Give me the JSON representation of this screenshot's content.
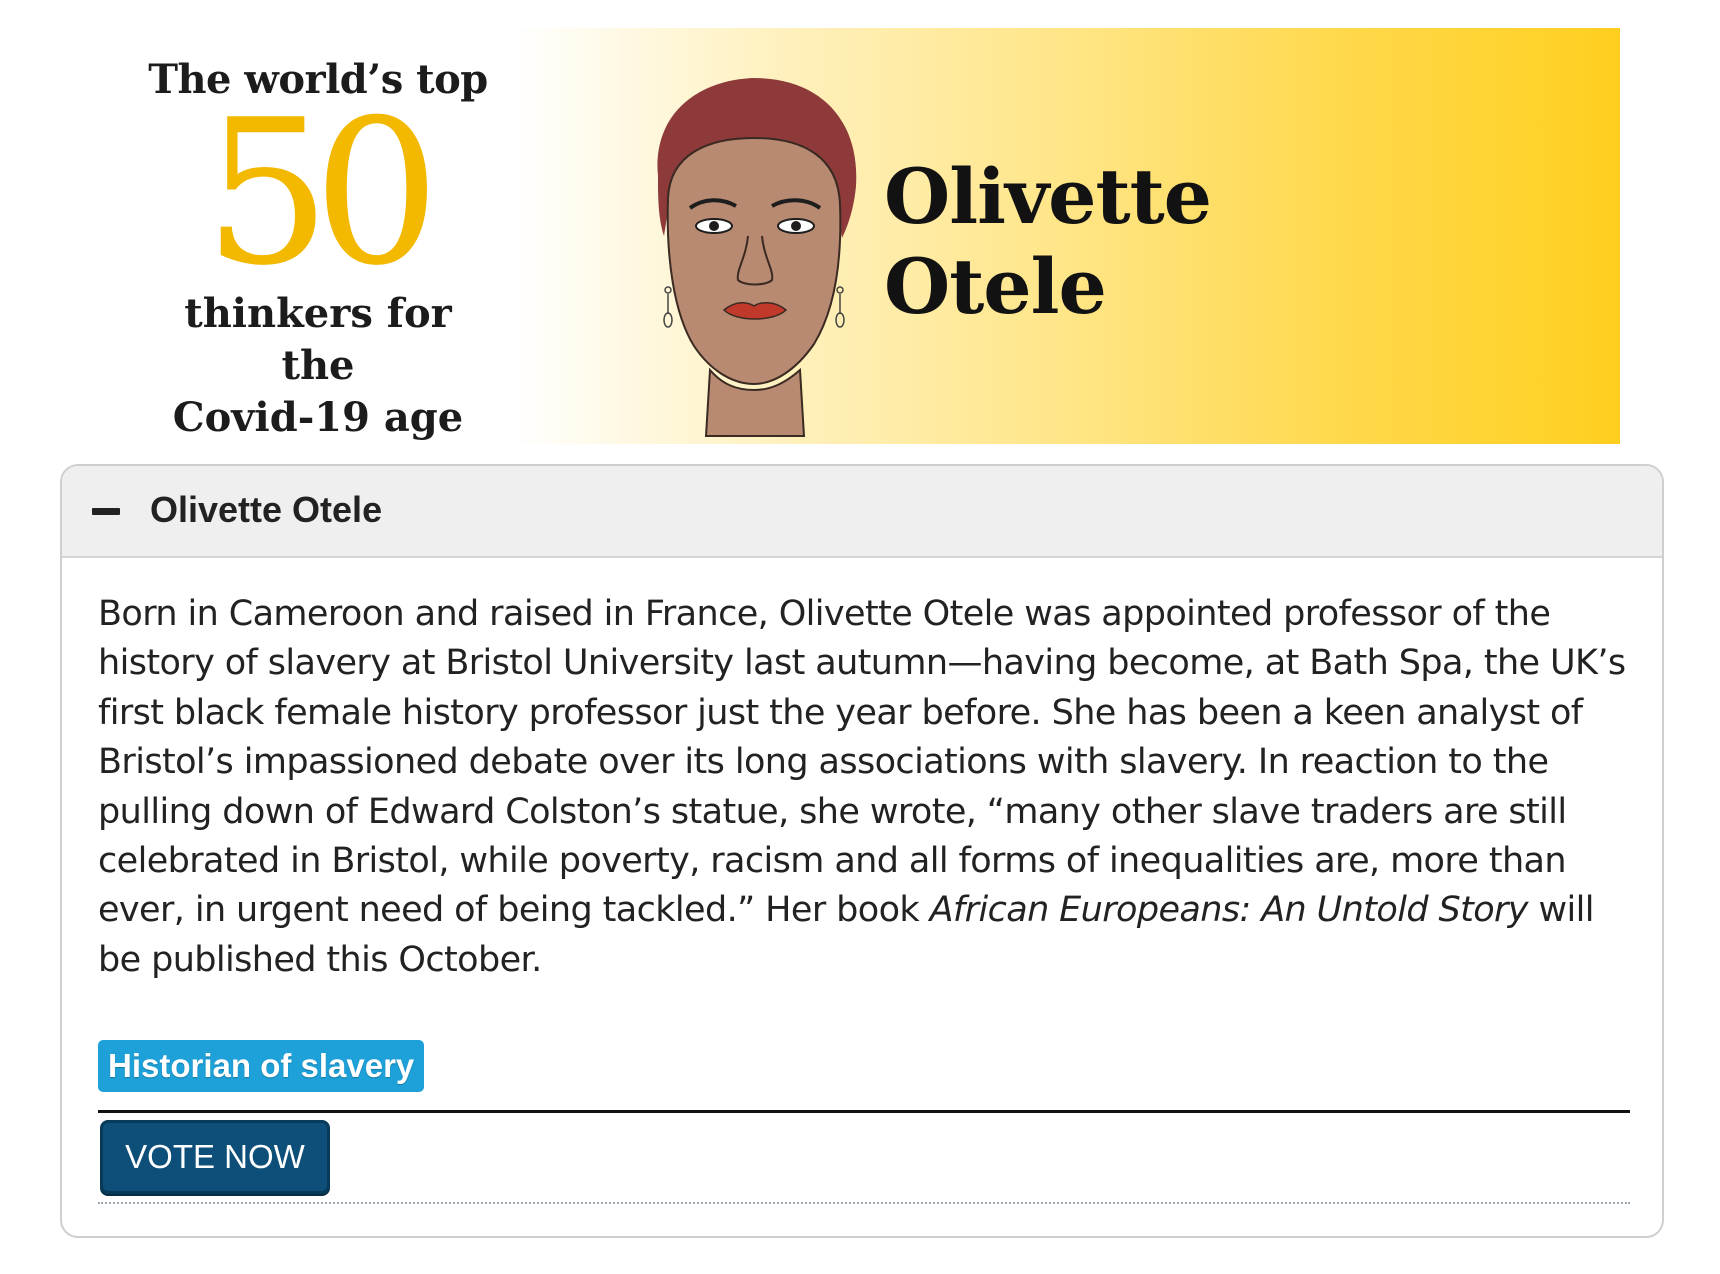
{
  "banner": {
    "brand_top": "The world’s top",
    "brand_number": "50",
    "brand_line1": "thinkers for the",
    "brand_line2": "Covid-19 age",
    "person_first": "Olivette",
    "person_last": "Otele",
    "colors": {
      "gold": "#f3b800",
      "gradient_end": "#ffcf1f"
    }
  },
  "panel": {
    "title": "Olivette Otele",
    "toggle_icon": "minus-icon",
    "bio_main": "Born in Cameroon and raised in France, Olivette Otele was appointed professor of the history of slavery at Bristol University last autumn—having become, at Bath Spa, the UK’s first black female history professor just the year before. She has been a keen analyst of Bristol’s impassioned debate over its long associations with slavery. In reaction to the pulling down of Edward Colston’s statue, she wrote, “many other slave traders are still celebrated in Bristol, while poverty, racism and all forms of inequalities are, more than ever, in urgent need of being tackled.” Her book ",
    "bio_book": "African Europeans: An Untold Story",
    "bio_end": " will be published this October.",
    "tag": "Historian of slavery",
    "vote_label": "VOTE NOW",
    "colors": {
      "tag_bg": "#1da1d8",
      "button_bg": "#0d4f78"
    }
  }
}
